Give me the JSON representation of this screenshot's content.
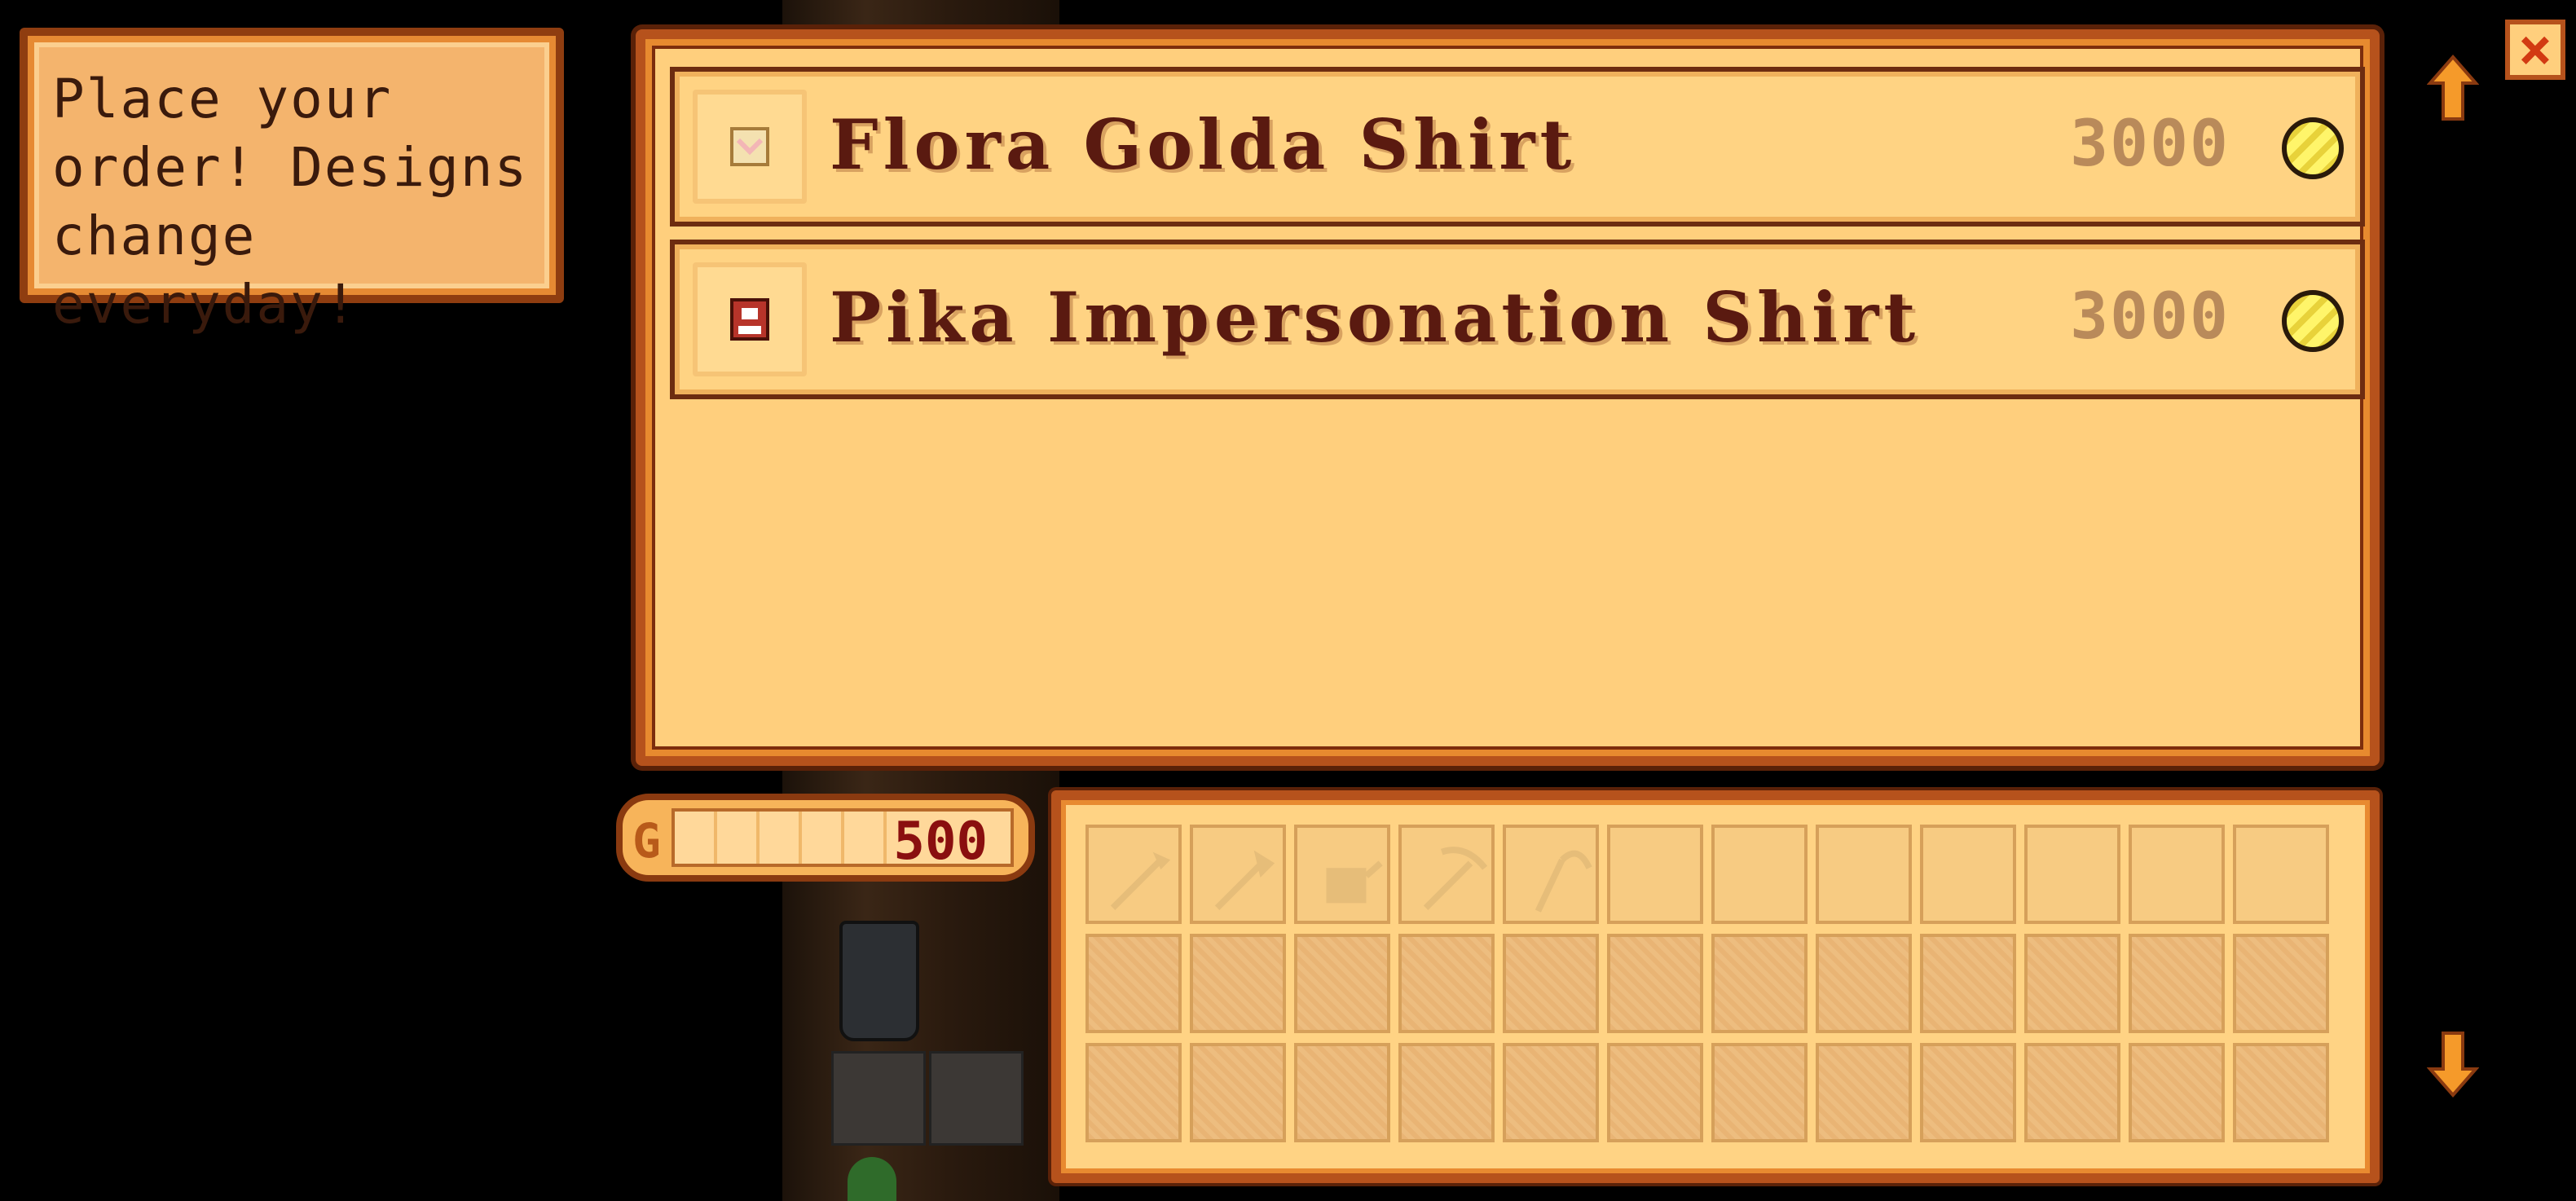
{
  "hint": {
    "text": "Place your\norder! Designs\nchange everyday!"
  },
  "shop": {
    "items": [
      {
        "name": "Flora Golda Shirt",
        "price": "3000",
        "icon": "flora-golda-shirt-icon"
      },
      {
        "name": "Pika Impersonation Shirt",
        "price": "3000",
        "icon": "pika-shirt-icon"
      }
    ]
  },
  "money": {
    "value": "500",
    "g_label": "G"
  },
  "controls": {
    "close": "×"
  },
  "inventory": {
    "tools": [
      "hoe-icon",
      "axe-icon",
      "watering-can-icon",
      "pickaxe-icon",
      "scythe-icon"
    ],
    "slots": 36
  },
  "colors": {
    "panel": "#ffcf7d",
    "border": "#b6521c",
    "text": "#5a1a10",
    "money": "#8a0f0f"
  }
}
